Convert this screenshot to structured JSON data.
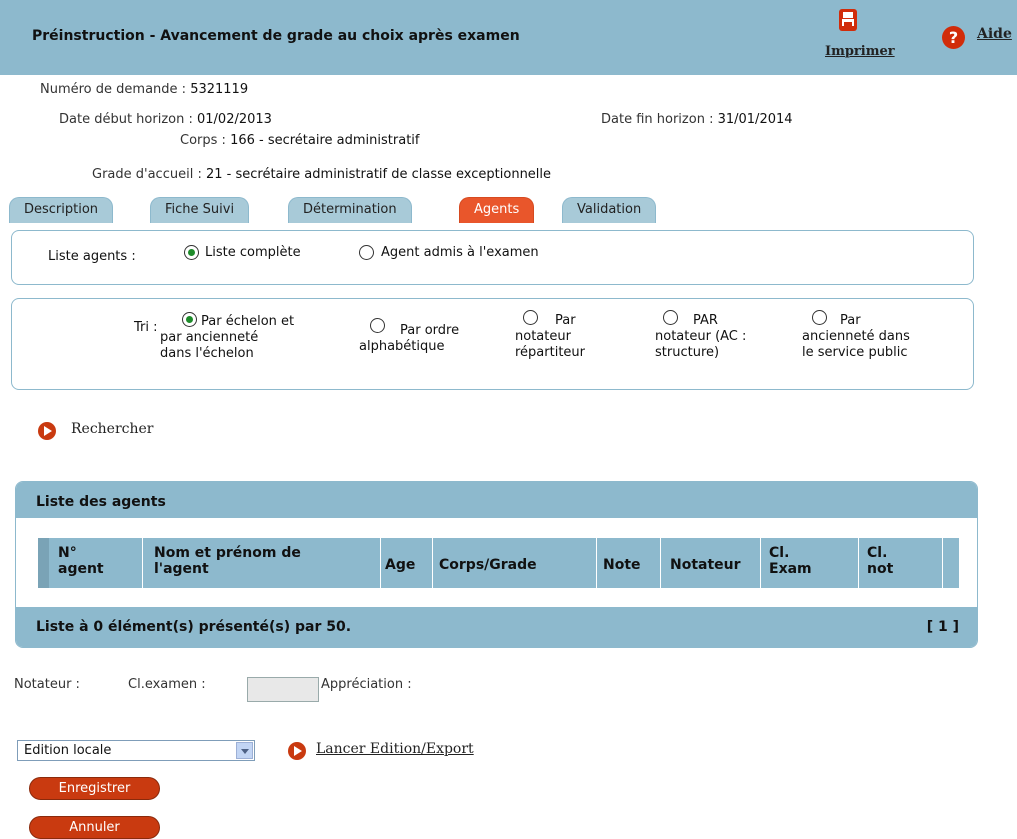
{
  "header": {
    "title": "Préinstruction - Avancement de grade au choix après examen",
    "print_label": "Imprimer",
    "help_label": "Aide"
  },
  "info": {
    "numero_label": "Numéro de demande :",
    "numero_value": "5321119",
    "date_debut_label": "Date début horizon :",
    "date_debut_value": "01/02/2013",
    "date_fin_label": "Date fin horizon :",
    "date_fin_value": "31/01/2014",
    "corps_label": "Corps :",
    "corps_value": "166 - secrétaire administratif",
    "grade_label": "Grade d'accueil :",
    "grade_value": "21 - secrétaire administratif de classe exceptionnelle"
  },
  "tabs": [
    "Description",
    "Fiche Suivi",
    "Détermination",
    "Agents",
    "Validation"
  ],
  "active_tab": "Agents",
  "liste_agents": {
    "label": "Liste agents :",
    "options": [
      "Liste complète",
      "Agent admis à l'examen"
    ],
    "selected": "Liste complète"
  },
  "tri": {
    "label": "Tri :",
    "options": [
      [
        "Par échelon et",
        "par ancienneté",
        "dans l'échelon"
      ],
      [
        "Par ordre",
        "alphabétique"
      ],
      [
        "Par",
        "notateur",
        "répartiteur"
      ],
      [
        "PAR",
        "notateur (AC :",
        "structure)"
      ],
      [
        "Par",
        "ancienneté dans",
        "le service public"
      ]
    ],
    "selected_index": 0
  },
  "search_label": "Rechercher",
  "table": {
    "title": "Liste des agents",
    "columns": [
      [
        "N°",
        "agent"
      ],
      [
        "Nom et prénom de",
        "l'agent"
      ],
      [
        "Age"
      ],
      [
        "Corps/Grade"
      ],
      [
        "Note"
      ],
      [
        "Notateur"
      ],
      [
        "Cl.",
        "Exam"
      ],
      [
        "Cl.",
        "not"
      ]
    ],
    "rows": [],
    "footer": "Liste à 0 élément(s) présenté(s) par 50.",
    "pagination": "[ 1 ]"
  },
  "form": {
    "notateur_label": "Notateur :",
    "clexamen_label": "Cl.examen :",
    "clexamen_value": "",
    "appreciation_label": "Appréciation :"
  },
  "edition": {
    "selected": "Edition locale",
    "launch_label": "Lancer Edition/Export"
  },
  "buttons": {
    "save": "Enregistrer",
    "cancel": "Annuler"
  },
  "colors": {
    "header": "#8db9cd",
    "accent": "#c93a10",
    "active_tab": "#e9562b"
  }
}
